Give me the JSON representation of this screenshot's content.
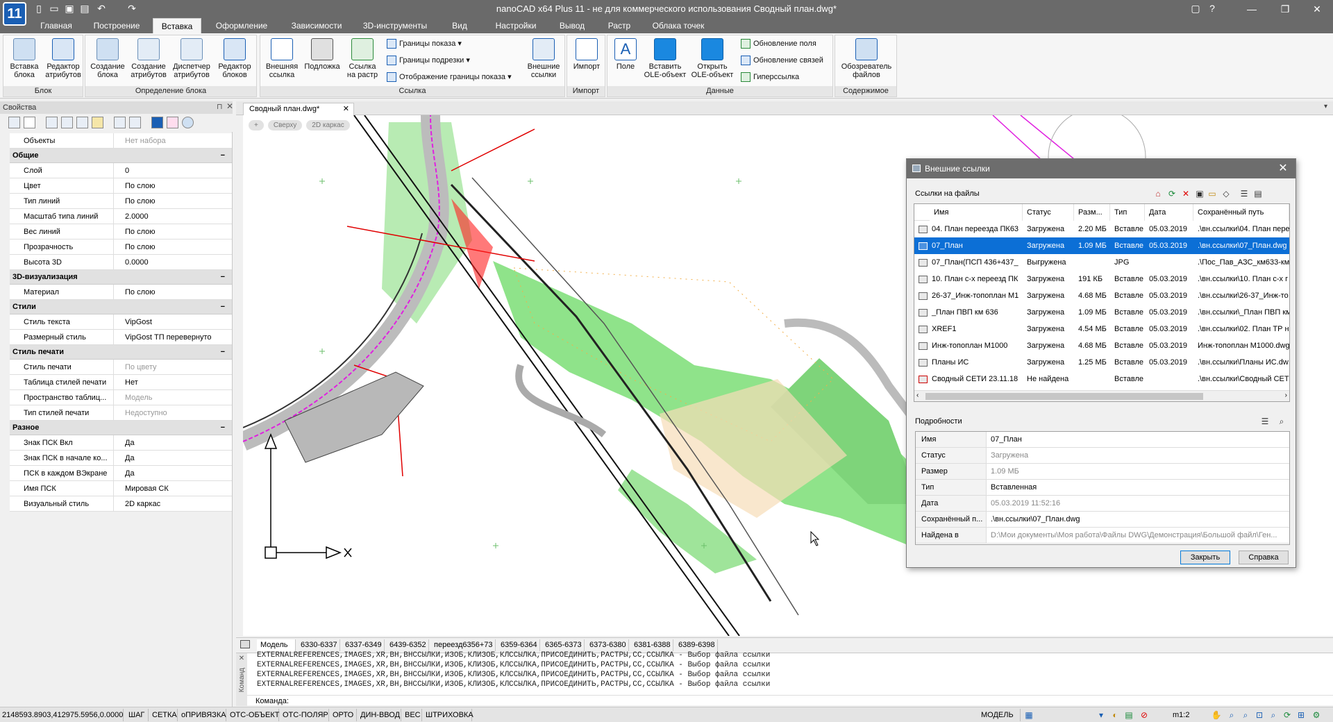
{
  "app": {
    "logo_text": "11",
    "title": "nanoCAD x64 Plus 11 - не для коммерческого использования Сводный план.dwg*",
    "help_icon": "?"
  },
  "menu": {
    "tabs": [
      "Главная",
      "Построение",
      "Вставка",
      "Оформление",
      "Зависимости",
      "3D-инструменты",
      "Вид",
      "Настройки",
      "Вывод",
      "Растр",
      "Облака точек"
    ],
    "active": "Вставка"
  },
  "ribbon": {
    "panels": {
      "block": {
        "title": "Блок",
        "buttons": [
          {
            "label": "Вставка блока"
          },
          {
            "label": "Редактор атрибутов"
          }
        ]
      },
      "blockdef": {
        "title": "Определение блока",
        "buttons": [
          {
            "label": "Создание блока"
          },
          {
            "label": "Создание атрибутов"
          },
          {
            "label": "Диспетчер атрибутов"
          },
          {
            "label": "Редактор блоков"
          }
        ]
      },
      "link": {
        "title": "Ссылка",
        "buttons": [
          {
            "label": "Внешняя ссылка"
          },
          {
            "label": "Подложка"
          },
          {
            "label": "Ссылка на растр"
          }
        ],
        "small": [
          "Границы показа",
          "Границы подрезки",
          "Отображение границы показа"
        ],
        "extra_button": "Внешние ссылки"
      },
      "import": {
        "title": "Импорт",
        "buttons": [
          {
            "label": "Импорт"
          }
        ]
      },
      "data": {
        "title": "Данные",
        "buttons": [
          {
            "label": "Поле"
          },
          {
            "label": "Вставить OLE-объект"
          },
          {
            "label": "Открыть OLE-объект"
          }
        ],
        "small": [
          "Обновление поля",
          "Обновление связей",
          "Гиперссылка"
        ]
      },
      "content": {
        "title": "Содержимое",
        "buttons": [
          {
            "label": "Обозреватель файлов"
          }
        ]
      }
    }
  },
  "properties": {
    "title": "Свойства",
    "selection_label": "Объекты",
    "selection_value": "Нет набора",
    "categories": [
      {
        "name": "Общие",
        "rows": [
          {
            "k": "Слой",
            "v": "0"
          },
          {
            "k": "Цвет",
            "v": "По слою"
          },
          {
            "k": "Тип линий",
            "v": "По слою"
          },
          {
            "k": "Масштаб типа линий",
            "v": "2.0000"
          },
          {
            "k": "Вес линий",
            "v": "По слою"
          },
          {
            "k": "Прозрачность",
            "v": "По слою"
          },
          {
            "k": "Высота 3D",
            "v": "0.0000"
          }
        ]
      },
      {
        "name": "3D-визуализация",
        "rows": [
          {
            "k": "Материал",
            "v": "По слою"
          }
        ]
      },
      {
        "name": "Стили",
        "rows": [
          {
            "k": "Стиль текста",
            "v": "VipGost"
          },
          {
            "k": "Размерный стиль",
            "v": "VipGost ТП перевернуто"
          }
        ]
      },
      {
        "name": "Стиль печати",
        "rows": [
          {
            "k": "Стиль печати",
            "v": "По цвету",
            "gray": true
          },
          {
            "k": "Таблица стилей печати",
            "v": "Нет"
          },
          {
            "k": "Пространство таблиц...",
            "v": "Модель",
            "gray": true
          },
          {
            "k": "Тип стилей печати",
            "v": "Недоступно",
            "gray": true
          }
        ]
      },
      {
        "name": "Разное",
        "rows": [
          {
            "k": "Знак ПСК Вкл",
            "v": "Да"
          },
          {
            "k": "Знак ПСК в начале ко...",
            "v": "Да"
          },
          {
            "k": "ПСК в каждом ВЭкране",
            "v": "Да"
          },
          {
            "k": "Имя ПСК",
            "v": "Мировая СК"
          },
          {
            "k": "Визуальный стиль",
            "v": "2D каркас"
          }
        ]
      }
    ]
  },
  "document": {
    "tab": "Сводный план.dwg*",
    "view_controls": [
      "+",
      "Сверху",
      "2D каркас"
    ]
  },
  "xref_dialog": {
    "title": "Внешние ссылки",
    "section_files": "Ссылки на файлы",
    "columns": [
      "Имя",
      "Статус",
      "Разм...",
      "Тип",
      "Дата",
      "Сохранённый путь"
    ],
    "rows": [
      {
        "name": "04. План переезда ПК63",
        "status": "Загружена",
        "size": "2.20 МБ",
        "type": "Вставле",
        "date": "05.03.2019 ",
        "path": ".\\вн.ссылки\\04. План пере"
      },
      {
        "name": "07_План",
        "status": "Загружена",
        "size": "1.09 МБ",
        "type": "Вставле",
        "date": "05.03.2019 ",
        "path": ".\\вн.ссылки\\07_План.dwg",
        "selected": true
      },
      {
        "name": "07_План(ПСП 436+437_",
        "status": "Выгружена",
        "size": "",
        "type": "JPG",
        "date": "",
        "path": ".\\Пос_Пав_АЗС_км633-км"
      },
      {
        "name": "10. План с-х переезд ПК",
        "status": "Загружена",
        "size": "191 КБ",
        "type": "Вставле",
        "date": "05.03.2019 ",
        "path": ".\\вн.ссылки\\10. План с-х г"
      },
      {
        "name": "26-37_Инж-топоплан М1",
        "status": "Загружена",
        "size": "4.68 МБ",
        "type": "Вставле",
        "date": "05.03.2019 ",
        "path": ".\\вн.ссылки\\26-37_Инж-то"
      },
      {
        "name": "_План ПВП км 636",
        "status": "Загружена",
        "size": "1.09 МБ",
        "type": "Вставле",
        "date": "05.03.2019 ",
        "path": ".\\вн.ссылки\\_План ПВП км"
      },
      {
        "name": "XREF1",
        "status": "Загружена",
        "size": "4.54 МБ",
        "type": "Вставле",
        "date": "05.03.2019 ",
        "path": ".\\вн.ссылки\\02. План ТР н"
      },
      {
        "name": "Инж-топоплан М1000",
        "status": "Загружена",
        "size": "4.68 МБ",
        "type": "Вставле",
        "date": "05.03.2019 ",
        "path": "Инж-топоплан М1000.dwg"
      },
      {
        "name": "Планы ИС",
        "status": "Загружена",
        "size": "1.25 МБ",
        "type": "Вставле",
        "date": "05.03.2019 ",
        "path": ".\\вн.ссылки\\Планы ИС.dw"
      },
      {
        "name": "Сводный СЕТИ 23.11.18",
        "status": "Не найдена",
        "size": "",
        "type": "Вставле",
        "date": "",
        "path": ".\\вн.ссылки\\Сводный СЕТ",
        "missing": true
      }
    ],
    "section_details": "Подробности",
    "details": [
      {
        "k": "Имя",
        "v": "07_План"
      },
      {
        "k": "Статус",
        "v": "Загружена",
        "gray": true
      },
      {
        "k": "Размер",
        "v": "1.09 МБ",
        "gray": true
      },
      {
        "k": "Тип",
        "v": "Вставленная"
      },
      {
        "k": "Дата",
        "v": "05.03.2019 11:52:16",
        "gray": true
      },
      {
        "k": "Сохранённый п...",
        "v": ".\\вн.ссылки\\07_План.dwg"
      },
      {
        "k": "Найдена в",
        "v": "D:\\Мои документы\\Моя работа\\Файлы DWG\\Демонстрация\\Большой файл\\Ген...",
        "gray": true
      }
    ],
    "btn_close": "Закрыть",
    "btn_help": "Справка"
  },
  "layout_tabs": [
    "Модель",
    "6330-6337",
    "6337-6349",
    "6439-6352",
    "переезд6356+73",
    "6359-6364",
    "6365-6373",
    "6373-6380",
    "6381-6388",
    "6389-6398"
  ],
  "command": {
    "side_label": "Команд",
    "history": [
      "EXTERNALREFERENCES,IMAGES,XR,ВН,ВНССЫЛКИ,ИЗОБ,КЛИЗОБ,КЛССЫЛКА,ПРИСОЕДИНИТЬ,РАСТРЫ,СС,ССЫЛКА - Выбор файла ссылки",
      "EXTERNALREFERENCES,IMAGES,XR,ВН,ВНССЫЛКИ,ИЗОБ,КЛИЗОБ,КЛССЫЛКА,ПРИСОЕДИНИТЬ,РАСТРЫ,СС,ССЫЛКА - Выбор файла ссылки",
      "EXTERNALREFERENCES,IMAGES,XR,ВН,ВНССЫЛКИ,ИЗОБ,КЛИЗОБ,КЛССЫЛКА,ПРИСОЕДИНИТЬ,РАСТРЫ,СС,ССЫЛКА - Выбор файла ссылки",
      "EXTERNALREFERENCES,IMAGES,XR,ВН,ВНССЫЛКИ,ИЗОБ,КЛИЗОБ,КЛССЫЛКА,ПРИСОЕДИНИТЬ,РАСТРЫ,СС,ССЫЛКА - Выбор файла ссылки"
    ],
    "prompt": "Команда:"
  },
  "status": {
    "coords": "2148593.8903,412975.5956,0.0000",
    "toggles": [
      "ШАГ",
      "СЕТКА",
      "оПРИВЯЗКА",
      "ОТС-ОБЪЕКТ",
      "ОТС-ПОЛЯР",
      "ОРТО",
      "ДИН-ВВОД",
      "ВЕС",
      "ШТРИХОВКА"
    ],
    "space": "МОДЕЛЬ",
    "scale": "m1:2"
  },
  "colors": {
    "accent": "#0c6fd6",
    "titlebar": "#6a6a6a",
    "vegetation": "#7ee07e",
    "road": "#bcbcbc",
    "redline": "#e00000"
  }
}
